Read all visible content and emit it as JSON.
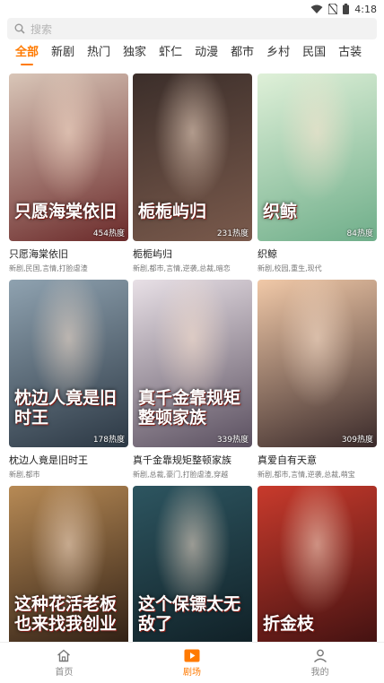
{
  "status_bar": {
    "time": "4:18"
  },
  "search": {
    "placeholder": "搜索"
  },
  "tabs": [
    {
      "label": "全部",
      "active": true
    },
    {
      "label": "新剧"
    },
    {
      "label": "热门"
    },
    {
      "label": "独家"
    },
    {
      "label": "虾仁"
    },
    {
      "label": "动漫"
    },
    {
      "label": "都市"
    },
    {
      "label": "乡村"
    },
    {
      "label": "民国"
    },
    {
      "label": "古装"
    }
  ],
  "dramas": [
    {
      "name": "只愿海棠依旧",
      "poster_text": "只愿海棠依旧",
      "heat": "454热度",
      "tags": "新剧,民国,言情,打脸虐渣",
      "colors": [
        "#d9c6b8",
        "#6b2a2a"
      ]
    },
    {
      "name": "栀栀屿归",
      "poster_text": "栀栀屿归",
      "heat": "231热度",
      "tags": "新剧,都市,言情,逆袭,总裁,暗恋",
      "colors": [
        "#3b2e2a",
        "#7a5a4c"
      ]
    },
    {
      "name": "织鲸",
      "poster_text": "织鲸",
      "heat": "84热度",
      "tags": "新剧,校园,重生,现代",
      "colors": [
        "#dff0d8",
        "#6fae8a"
      ]
    },
    {
      "name": "枕边人竟是旧时王",
      "poster_text": "枕边人竟是旧时王",
      "heat": "178热度",
      "tags": "新剧,都市",
      "colors": [
        "#8fa2b0",
        "#2c3844"
      ]
    },
    {
      "name": "真千金靠规矩整顿家族",
      "poster_text": "真千金靠规矩整顿家族",
      "heat": "339热度",
      "tags": "新剧,总裁,豪门,打脸虐渣,穿越",
      "colors": [
        "#e8e0e6",
        "#5b5060"
      ]
    },
    {
      "name": "真爱自有天意",
      "poster_text": "",
      "heat": "309热度",
      "tags": "新剧,都市,言情,逆袭,总裁,萌宝",
      "colors": [
        "#f1c9a8",
        "#3a2a2a"
      ]
    },
    {
      "name": "",
      "poster_text": "这种花活老板也来找我创业",
      "heat": "",
      "tags": "",
      "colors": [
        "#b78a55",
        "#2a1b12"
      ]
    },
    {
      "name": "",
      "poster_text": "这个保镖太无敌了",
      "heat": "",
      "tags": "",
      "colors": [
        "#2d5560",
        "#0f1e24"
      ]
    },
    {
      "name": "",
      "poster_text": "折金枝",
      "heat": "",
      "tags": "",
      "colors": [
        "#c83a2c",
        "#3d1010"
      ]
    }
  ],
  "bottom_nav": [
    {
      "label": "首页",
      "icon": "home-icon"
    },
    {
      "label": "剧场",
      "icon": "theater-play-icon",
      "active": true,
      "color": "#ff7a00"
    },
    {
      "label": "我的",
      "icon": "profile-icon"
    }
  ],
  "accent_color": "#ff7a00"
}
